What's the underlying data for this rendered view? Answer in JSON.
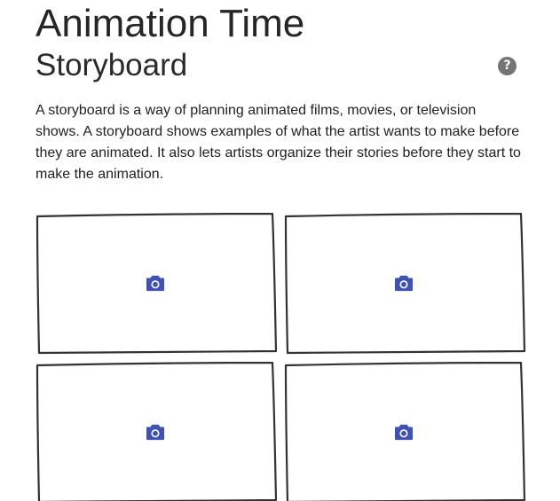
{
  "page": {
    "title": "Animation Time",
    "subtitle": "Storyboard",
    "help_icon": "help-circle-icon",
    "help_glyph": "?",
    "description": "A storyboard is a way of planning animated films, movies, or television shows. A storyboard shows examples of what the artist wants to make before they are animated. It also lets artists organize their stories before they start to make the animation."
  },
  "storyboard": {
    "frames": [
      {
        "icon": "camera-icon"
      },
      {
        "icon": "camera-icon"
      },
      {
        "icon": "camera-icon"
      },
      {
        "icon": "camera-icon"
      }
    ]
  },
  "colors": {
    "accent": "#3f51b5",
    "frame_stroke": "#333333",
    "help_bg": "#757575"
  }
}
